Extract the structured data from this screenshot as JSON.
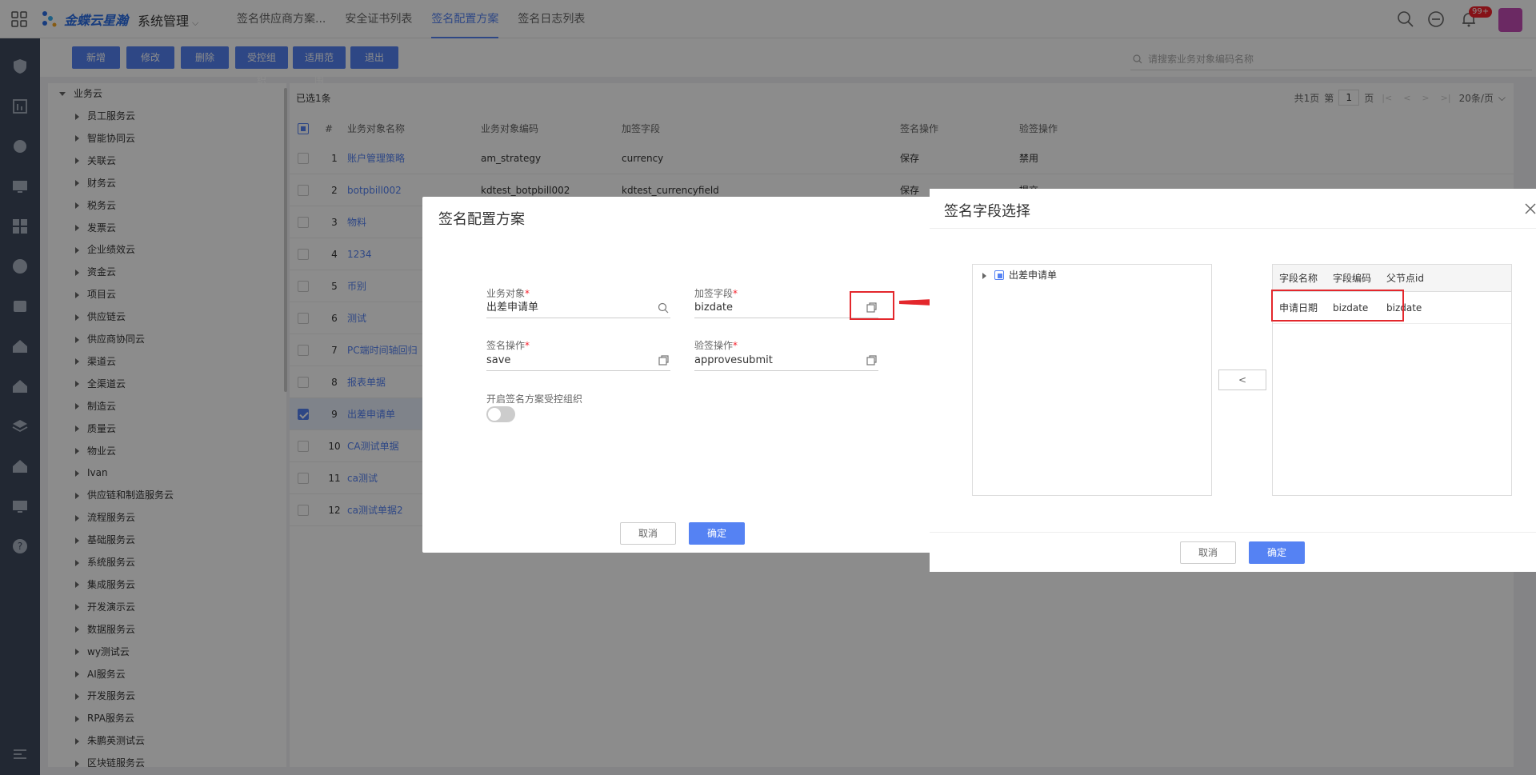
{
  "app": {
    "logo_text": "金蝶云星瀚",
    "system_menu": "系统管理",
    "tabs": [
      "签名供应商方案...",
      "安全证书列表",
      "签名配置方案",
      "签名日志列表"
    ],
    "active_tab": 2,
    "notification_badge": "99+"
  },
  "toolbar": {
    "buttons": [
      "新增",
      "修改",
      "删除",
      "受控组织",
      "适用范围",
      "退出"
    ],
    "search_placeholder": "请搜索业务对象编码名称"
  },
  "tree": {
    "root": "业务云",
    "items": [
      "员工服务云",
      "智能协同云",
      "关联云",
      "财务云",
      "税务云",
      "发票云",
      "企业绩效云",
      "资金云",
      "项目云",
      "供应链云",
      "供应商协同云",
      "渠道云",
      "全渠道云",
      "制造云",
      "质量云",
      "物业云",
      "Ivan",
      "供应链和制造服务云",
      "流程服务云",
      "基础服务云",
      "系统服务云",
      "集成服务云",
      "开发演示云",
      "数据服务云",
      "wy测试云",
      "AI服务云",
      "开发服务云",
      "RPA服务云",
      "朱鹏英测试云",
      "区块链服务云"
    ]
  },
  "table": {
    "selected_info": "已选1条",
    "pager": {
      "total_pages": "共1页",
      "page_label": "第",
      "page": "1",
      "page_suffix": "页",
      "page_size": "20条/页"
    },
    "columns": [
      "#",
      "业务对象名称",
      "业务对象编码",
      "加签字段",
      "签名操作",
      "验签操作"
    ],
    "rows": [
      {
        "no": "1",
        "name": "账户管理策略",
        "code": "am_strategy",
        "field": "currency",
        "sign": "保存",
        "verify": "禁用"
      },
      {
        "no": "2",
        "name": "botpbill002",
        "code": "kdtest_botpbill002",
        "field": "kdtest_currencyfield",
        "sign": "保存",
        "verify": "提交"
      },
      {
        "no": "3",
        "name": "物料",
        "code": "",
        "field": "",
        "sign": "",
        "verify": ""
      },
      {
        "no": "4",
        "name": "1234",
        "code": "",
        "field": "",
        "sign": "",
        "verify": ""
      },
      {
        "no": "5",
        "name": "币别",
        "code": "",
        "field": "",
        "sign": "",
        "verify": ""
      },
      {
        "no": "6",
        "name": "测试",
        "code": "",
        "field": "",
        "sign": "",
        "verify": ""
      },
      {
        "no": "7",
        "name": "PC端时间轴回归",
        "code": "",
        "field": "",
        "sign": "",
        "verify": ""
      },
      {
        "no": "8",
        "name": "报表单据",
        "code": "",
        "field": "",
        "sign": "",
        "verify": ""
      },
      {
        "no": "9",
        "name": "出差申请单",
        "code": "",
        "field": "",
        "sign": "",
        "verify": ""
      },
      {
        "no": "10",
        "name": "CA测试单据",
        "code": "",
        "field": "",
        "sign": "",
        "verify": ""
      },
      {
        "no": "11",
        "name": "ca测试",
        "code": "",
        "field": "",
        "sign": "",
        "verify": ""
      },
      {
        "no": "12",
        "name": "ca测试单据2",
        "code": "",
        "field": "",
        "sign": "",
        "verify": ""
      }
    ],
    "selected_row": 8
  },
  "dialog1": {
    "title": "签名配置方案",
    "biz_object_label": "业务对象",
    "biz_object_value": "出差申请单",
    "sign_field_label": "加签字段",
    "sign_field_value": "bizdate",
    "sign_op_label": "签名操作",
    "sign_op_value": "save",
    "verify_op_label": "验签操作",
    "verify_op_value": "approvesubmit",
    "toggle_label": "开启签名方案受控组织",
    "cancel": "取消",
    "confirm": "确定"
  },
  "dialog2": {
    "title": "签名字段选择",
    "tree_node": "出差申请单",
    "move_button": "<",
    "columns": [
      "字段名称",
      "字段编码",
      "父节点id"
    ],
    "row": {
      "name": "申请日期",
      "code": "bizdate",
      "parent": "bizdate"
    },
    "cancel": "取消",
    "confirm": "确定"
  },
  "colors": {
    "primary": "#5582f3",
    "highlight": "#e3272c",
    "rail": "#3e4a5e"
  }
}
